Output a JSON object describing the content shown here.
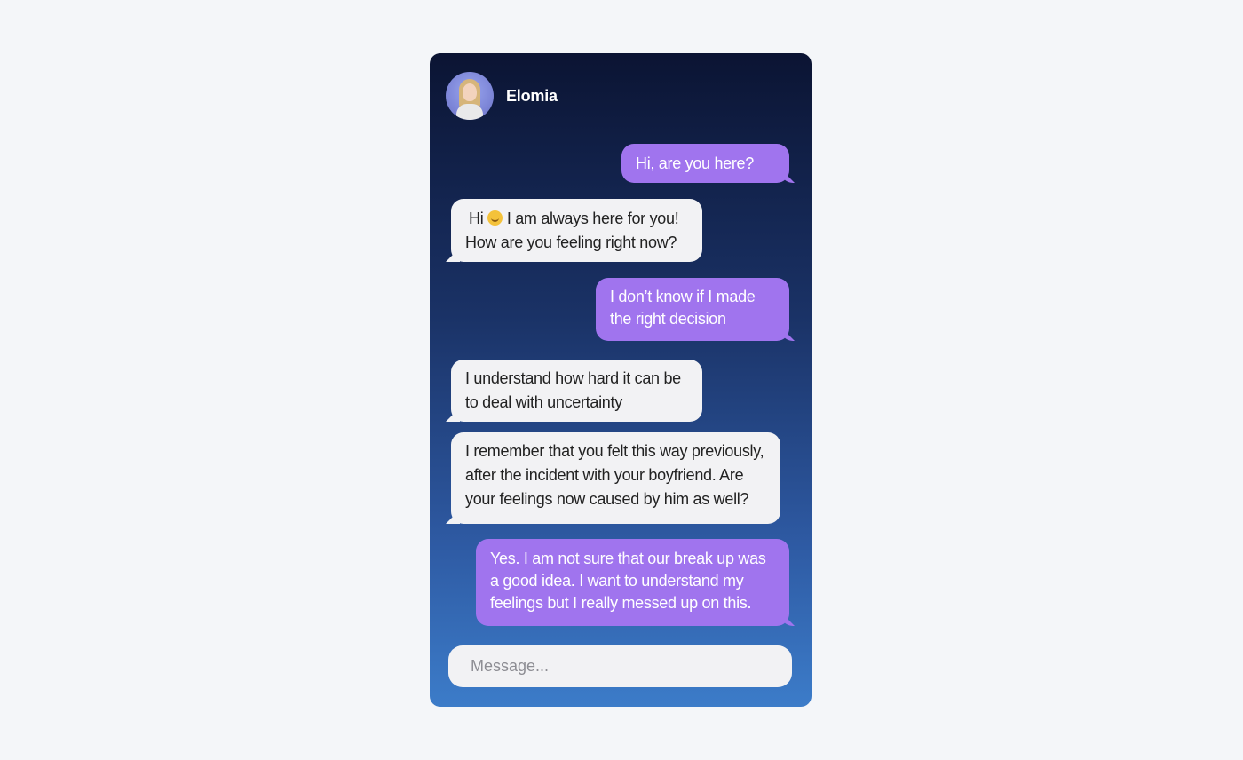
{
  "contact": {
    "name": "Elomia",
    "avatar_icon": "avatar-icon"
  },
  "messages": [
    {
      "direction": "outgoing",
      "lines": [
        "Hi, are you here?"
      ]
    },
    {
      "direction": "incoming",
      "lines": [
        "Hi",
        "I am always here for you!",
        "How are you feeling right now?"
      ],
      "emoji": "smiling-face"
    },
    {
      "direction": "outgoing",
      "lines": [
        "I don’t know if I made",
        "the right decision"
      ]
    },
    {
      "direction": "incoming",
      "lines": [
        "I understand how hard it can be",
        "to deal with uncertainty"
      ]
    },
    {
      "direction": "incoming",
      "lines": [
        "I remember that you felt this way previously,",
        "after the incident with your boyfriend. Are",
        "your feelings now caused by him as well?"
      ]
    },
    {
      "direction": "outgoing",
      "lines": [
        "Yes. I am not sure that our break up was",
        "a good idea. I want to understand my",
        "feelings but I really messed up on this."
      ]
    }
  ],
  "composer": {
    "placeholder": "Message..."
  },
  "colors": {
    "page_background": "#f4f6f9",
    "outgoing_bubble": "#a074ee",
    "incoming_bubble": "#f2f2f4",
    "gradient_top": "#0b1433",
    "gradient_bottom": "#3c7cc9"
  }
}
